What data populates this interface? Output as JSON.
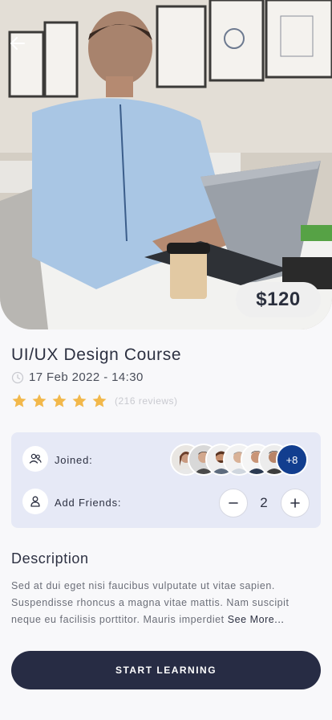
{
  "course": {
    "price": "$120",
    "title": "UI/UX Design Course",
    "datetime": "17 Feb 2022 - 14:30",
    "rating": 5,
    "reviews_label": "(216 reviews)"
  },
  "participants": {
    "joined_label": "Joined:",
    "extra_count": "+8",
    "avatar_count_visible": 6
  },
  "friends": {
    "label": "Add Friends:",
    "minus_symbol": "−",
    "plus_symbol": "+",
    "count": "2"
  },
  "description": {
    "heading": "Description",
    "body": "Sed at dui eget nisi faucibus vulputate ut vitae sapien. Suspendisse rhoncus a magna vitae mattis. Nam suscipit neque eu facilisis porttitor. Mauris imperdiet ",
    "see_more": "See More..."
  },
  "cta": {
    "label": "START LEARNING"
  },
  "colors": {
    "primary": "#272c44",
    "star": "#f2b84b",
    "card_bg": "#e6e9f6",
    "badge": "#123e8f"
  },
  "icons": {
    "back": "arrow-left-icon",
    "date": "clock-icon",
    "joined": "users-icon",
    "friends": "user-icon",
    "minus": "minus-icon",
    "plus": "plus-icon",
    "star": "star-icon"
  }
}
